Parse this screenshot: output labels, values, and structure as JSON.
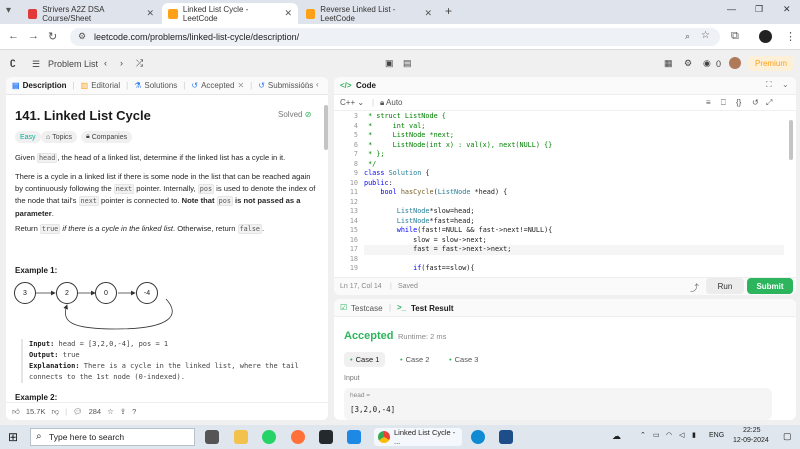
{
  "browser": {
    "tabs": [
      {
        "title": "Strivers A2Z DSA Course/Sheet",
        "favicon_color": "#e03a3a"
      },
      {
        "title": "Linked List Cycle - LeetCode",
        "favicon_color": "#ffa116"
      },
      {
        "title": "Reverse Linked List - LeetCode",
        "favicon_color": "#ffa116"
      }
    ],
    "url": "leetcode.com/problems/linked-list-cycle/description/"
  },
  "lc_header": {
    "problem_list": "Problem List",
    "fire_count": "0",
    "premium": "Premium"
  },
  "left_tabs": [
    {
      "label": "Description"
    },
    {
      "label": "Editorial"
    },
    {
      "label": "Solutions"
    },
    {
      "label": "Accepted"
    },
    {
      "label": "Submissions"
    }
  ],
  "problem": {
    "title": "141. Linked List Cycle",
    "status": "Solved",
    "difficulty": "Easy",
    "topics": "Topics",
    "companies": "Companies",
    "p1_a": "Given ",
    "p1_code": "head",
    "p1_b": ", the head of a linked list, determine if the linked list has a cycle in it.",
    "p2_a": "There is a cycle in a linked list if there is some node in the list that can be reached again by continuously following the ",
    "p2_code1": "next",
    "p2_b": " pointer. Internally, ",
    "p2_code2": "pos",
    "p2_c": " is used to denote the index of the node that tail's ",
    "p2_code3": "next",
    "p2_d": " pointer is connected to. ",
    "p2_bold1": "Note that ",
    "p2_code4": "pos",
    "p2_bold2": " is not passed as a parameter",
    "p2_e": ".",
    "p3_a": "Return ",
    "p3_code1": "true",
    "p3_b": " if there is a cycle in the linked list",
    "p3_c": ". Otherwise, return ",
    "p3_code2": "false",
    "p3_d": ".",
    "example1_title": "Example 1:",
    "nodes": [
      "3",
      "2",
      "0",
      "-4"
    ],
    "example1_input_label": "Input:",
    "example1_input": "head = [3,2,0,-4], pos = 1",
    "example1_output_label": "Output:",
    "example1_output": "true",
    "example1_expl_label": "Explanation:",
    "example1_expl": "There is a cycle in the linked list, where the tail connects to the 1st node (0-indexed).",
    "example2_title": "Example 2:",
    "likes": "15.7K",
    "comments": "284"
  },
  "code_panel": {
    "title": "Code",
    "language": "C++",
    "mode": "Auto",
    "line_numbers": [
      "3",
      "4",
      "5",
      "6",
      "7",
      "8",
      "9",
      "10",
      "11",
      "12",
      "13",
      "14",
      "15",
      "16",
      "17",
      "18",
      "19"
    ],
    "status_pos": "Ln 17, Col 14",
    "saved": "Saved",
    "run": "Run",
    "submit": "Submit"
  },
  "result_panel": {
    "tab_testcase": "Testcase",
    "tab_result": "Test Result",
    "verdict": "Accepted",
    "runtime": "Runtime: 2 ms",
    "cases": [
      "Case 1",
      "Case 2",
      "Case 3"
    ],
    "input_label": "Input",
    "var_name": "head =",
    "var_value": "[3,2,0,-4]"
  },
  "taskbar": {
    "search_placeholder": "Type here to search",
    "active_app": "Linked List Cycle - ...",
    "lang": "ENG",
    "time": "22:25",
    "date": "12-09-2024"
  }
}
